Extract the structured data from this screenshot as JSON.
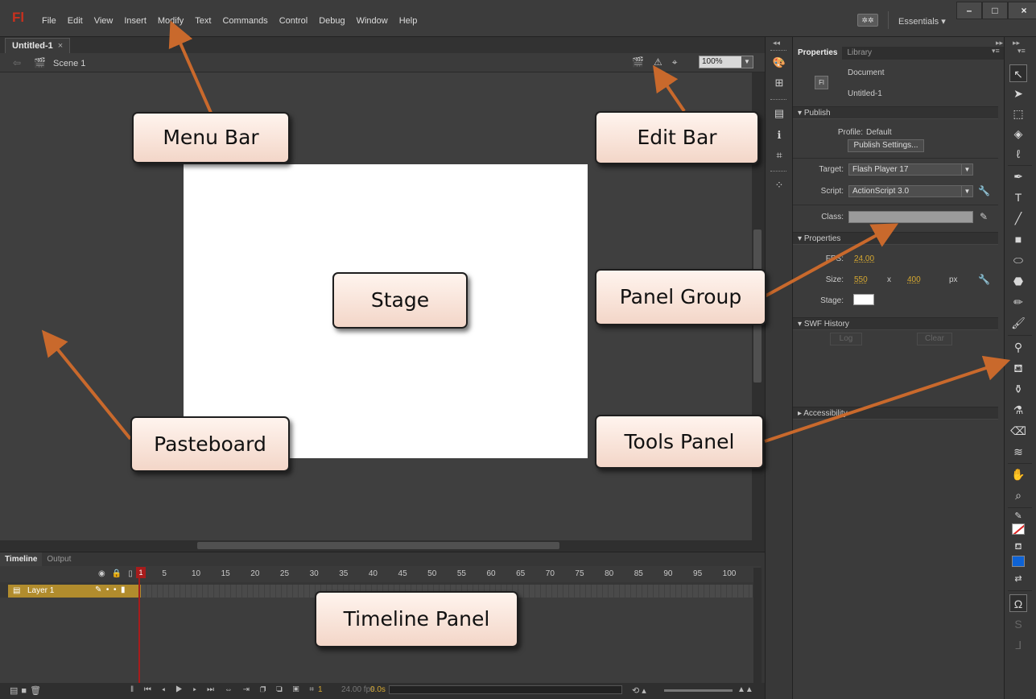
{
  "app": {
    "logo": "Fl",
    "menu": [
      "File",
      "Edit",
      "View",
      "Insert",
      "Modify",
      "Text",
      "Commands",
      "Control",
      "Debug",
      "Window",
      "Help"
    ],
    "workspace": "Essentials",
    "window_buttons": [
      "–",
      "□",
      "×"
    ]
  },
  "document": {
    "tab_label": "Untitled-1",
    "tab_close": "×",
    "scene_label": "Scene 1",
    "zoom": "100%"
  },
  "timeline": {
    "tabs": [
      "Timeline",
      "Output"
    ],
    "frame_numbers": [
      "1",
      "5",
      "10",
      "15",
      "20",
      "25",
      "30",
      "35",
      "40",
      "45",
      "50",
      "55",
      "60",
      "65",
      "70",
      "75",
      "80",
      "85",
      "90",
      "95",
      "100"
    ],
    "layer_name": "Layer 1",
    "current_frame": "1",
    "fps": "24.00 fps",
    "time": "0.0s"
  },
  "properties": {
    "tabs": [
      "Properties",
      "Library"
    ],
    "doc_icon": "Fl",
    "doc_type": "Document",
    "doc_name": "Untitled-1",
    "publish": {
      "header": "Publish",
      "profile_label": "Profile:",
      "profile_value": "Default",
      "settings_button": "Publish Settings...",
      "target_label": "Target:",
      "target_value": "Flash Player 17",
      "script_label": "Script:",
      "script_value": "ActionScript 3.0",
      "class_label": "Class:"
    },
    "props_section": {
      "header": "Properties",
      "fps_label": "FPS:",
      "fps_value": "24.00",
      "size_label": "Size:",
      "width": "550",
      "x": "x",
      "height": "400",
      "unit": "px",
      "stage_label": "Stage:",
      "stage_color": "#ffffff"
    },
    "swf_history": {
      "header": "SWF History",
      "log_button": "Log",
      "clear_button": "Clear"
    },
    "accessibility_header": "Accessibility"
  },
  "callouts": {
    "menu_bar": "Menu Bar",
    "edit_bar": "Edit Bar",
    "stage": "Stage",
    "panel_group": "Panel Group",
    "pasteboard": "Pasteboard",
    "tools_panel": "Tools Panel",
    "timeline_panel": "Timeline Panel"
  },
  "colors": {
    "accent_orange": "#d6a830",
    "arrow": "#c9692c",
    "logo_red": "#c9301e",
    "fill_color": "#0e63d6"
  }
}
